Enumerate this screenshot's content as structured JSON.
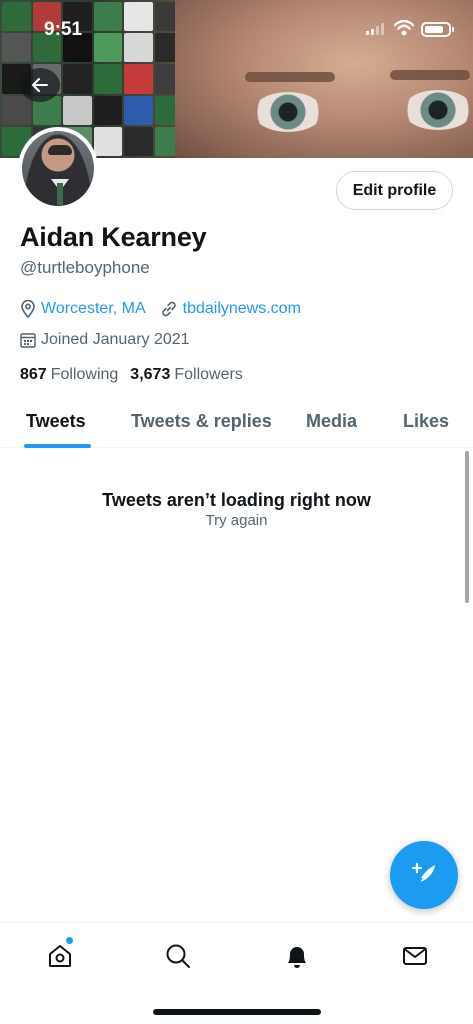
{
  "status_bar": {
    "time": "9:51"
  },
  "header": {
    "back_icon": "arrow-left-icon"
  },
  "profile": {
    "edit_label": "Edit profile",
    "name": "Aidan Kearney",
    "handle": "@turtleboyphone",
    "location": "Worcester, MA",
    "website": "tbdailynews.com",
    "joined": "Joined January 2021",
    "following_count": "867",
    "following_label": "Following",
    "followers_count": "3,673",
    "followers_label": "Followers"
  },
  "tabs": [
    {
      "label": "Tweets",
      "active": true
    },
    {
      "label": "Tweets & replies",
      "active": false
    },
    {
      "label": "Media",
      "active": false
    },
    {
      "label": "Likes",
      "active": false
    }
  ],
  "empty_state": {
    "title": "Tweets aren’t loading right now",
    "action": "Try again"
  },
  "fab": {
    "icon": "compose-feather-icon"
  },
  "bottom_nav": [
    {
      "icon": "home-icon",
      "has_badge": true
    },
    {
      "icon": "search-icon"
    },
    {
      "icon": "bell-icon"
    },
    {
      "icon": "mail-icon"
    }
  ],
  "colors": {
    "accent": "#1d9bf0",
    "text": "#0f1419",
    "secondary": "#536471"
  }
}
